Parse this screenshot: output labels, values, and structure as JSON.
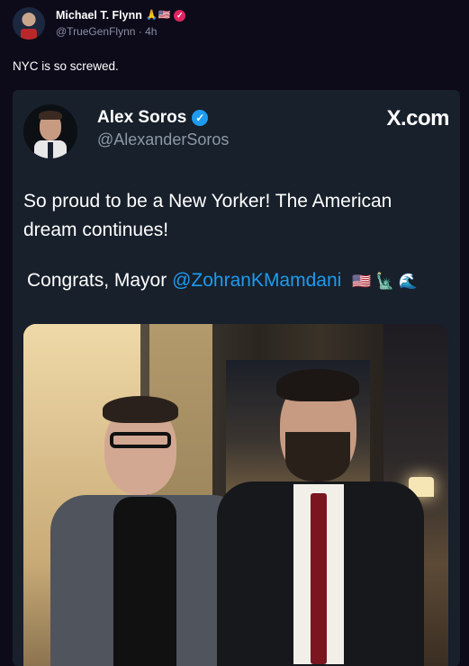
{
  "post": {
    "author_name": "Michael T. Flynn",
    "author_emojis": "🙏🇺🇸",
    "handle": "@TrueGenFlynn",
    "separator": "·",
    "time": "4h",
    "text": "NYC is so screwed."
  },
  "embed": {
    "name": "Alex Soros",
    "handle": "@AlexanderSoros",
    "brand": "X.com",
    "body_line1": "So proud to be a New Yorker! The American",
    "body_line2": "dream continues!",
    "congrats_prefix": "Congrats, Mayor",
    "mention": "@ZohranKMamdani",
    "flags": "🇺🇸 🗽 🌊"
  },
  "colors": {
    "background": "#0d0b1a",
    "card": "#17202b",
    "link": "#1d9bf0",
    "verified_blue": "#1d9bf0",
    "verified_pink": "#e0245e"
  },
  "icons": {
    "post_verified": "pink-verified-badge-icon",
    "embed_verified": "blue-verified-badge-icon"
  }
}
